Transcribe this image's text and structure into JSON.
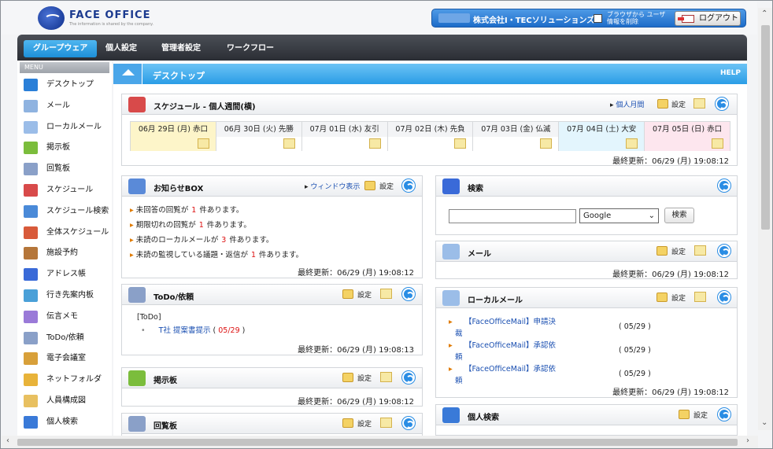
{
  "header": {
    "logo_text": "FACE OFFICE",
    "logo_tagline": "The information is shared by the company.",
    "company": "株式会社I・TECソリューションズ",
    "clear_option": "ブラウザから ユーザ情報を削除",
    "logout_label": "ログアウト"
  },
  "nav": {
    "tabs": [
      {
        "label": "グループウェア",
        "active": true
      },
      {
        "label": "個人設定",
        "active": false
      },
      {
        "label": "管理者設定",
        "active": false
      },
      {
        "label": "ワークフロー",
        "active": false
      }
    ]
  },
  "sidebar": {
    "header": "MENU",
    "items": [
      {
        "label": "デスクトップ",
        "icon": "home-arrow-icon",
        "color": "#2a7fd8"
      },
      {
        "label": "メール",
        "icon": "envelope-icon",
        "color": "#8fb3e0"
      },
      {
        "label": "ローカルメール",
        "icon": "local-mail-icon",
        "color": "#9bbde8"
      },
      {
        "label": "掲示板",
        "icon": "bulletin-board-icon",
        "color": "#7bbd3c"
      },
      {
        "label": "回覧板",
        "icon": "circular-board-icon",
        "color": "#8aa0c8"
      },
      {
        "label": "スケジュール",
        "icon": "schedule-icon",
        "color": "#d84a4a"
      },
      {
        "label": "スケジュール検索",
        "icon": "schedule-search-icon",
        "color": "#4a8ad8"
      },
      {
        "label": "全体スケジュール",
        "icon": "all-schedule-icon",
        "color": "#d85a3a"
      },
      {
        "label": "施設予約",
        "icon": "facility-door-icon",
        "color": "#b5763a"
      },
      {
        "label": "アドレス帳",
        "icon": "address-book-icon",
        "color": "#3a6ad8"
      },
      {
        "label": "行き先案内板",
        "icon": "destination-board-icon",
        "color": "#4aa0d8"
      },
      {
        "label": "伝言メモ",
        "icon": "memo-icon",
        "color": "#9a7ad8"
      },
      {
        "label": "ToDo/依頼",
        "icon": "todo-icon",
        "color": "#8aa0c8"
      },
      {
        "label": "電子会議室",
        "icon": "meeting-room-icon",
        "color": "#d8a03a"
      },
      {
        "label": "ネットフォルダ",
        "icon": "folder-icon",
        "color": "#e8b33a"
      },
      {
        "label": "人員構成図",
        "icon": "org-chart-icon",
        "color": "#e8c060"
      },
      {
        "label": "個人検索",
        "icon": "person-search-icon",
        "color": "#3a7ad8"
      }
    ]
  },
  "desktop": {
    "title": "デスクトップ",
    "help": "HELP"
  },
  "schedule": {
    "title": "スケジュール - 個人週間(横)",
    "monthly_link": "個人月間",
    "settings": "設定",
    "days": [
      {
        "label": "06月 29日 (月) 赤口",
        "bg": "#fdf5c9"
      },
      {
        "label": "06月 30日 (火) 先勝",
        "bg": "#ffffff"
      },
      {
        "label": "07月 01日 (水) 友引",
        "bg": "#ffffff"
      },
      {
        "label": "07月 02日 (木) 先負",
        "bg": "#ffffff"
      },
      {
        "label": "07月 03日 (金) 仏滅",
        "bg": "#ffffff"
      },
      {
        "label": "07月 04日 (土) 大安",
        "bg": "#e3f5fd"
      },
      {
        "label": "07月 05日 (日) 赤口",
        "bg": "#fde6ee"
      }
    ],
    "updated": "最終更新：06/29 (月) 19:08:12"
  },
  "notice": {
    "title": "お知らせBOX",
    "window_link": "ウィンドウ表示",
    "settings": "設定",
    "lines": [
      {
        "pre": "未回答の回覧が",
        "num": "1",
        "post": "件あります。"
      },
      {
        "pre": "期限切れの回覧が",
        "num": "1",
        "post": "件あります。"
      },
      {
        "pre": "未読のローカルメールが",
        "num": "3",
        "post": "件あります。"
      },
      {
        "pre": "未読の監視している議題・返信が",
        "num": "1",
        "post": "件あります。"
      }
    ],
    "updated": "最終更新：06/29 (月) 19:08:12"
  },
  "search": {
    "title": "検索",
    "engine": "Google",
    "button": "検索",
    "query": ""
  },
  "mail": {
    "title": "メール",
    "settings": "設定",
    "updated": "最終更新：06/29 (月) 19:08:12"
  },
  "todo": {
    "title": "ToDo/依頼",
    "settings": "設定",
    "section": "[ToDo]",
    "item_text": "T社 提案書提示",
    "item_date": "05/29",
    "updated": "最終更新：06/29 (月) 19:08:13"
  },
  "localmail": {
    "title": "ローカルメール",
    "settings": "設定",
    "items": [
      {
        "line1": "【FaceOfficeMail】申請決",
        "line2": "裁",
        "date": "( 05/29 )"
      },
      {
        "line1": "【FaceOfficeMail】承認依",
        "line2": "頼",
        "date": "( 05/29 )"
      },
      {
        "line1": "【FaceOfficeMail】承認依",
        "line2": "頼",
        "date": "( 05/29 )"
      }
    ],
    "updated": "最終更新：06/29 (月) 19:08:12"
  },
  "bulletin": {
    "title": "掲示板",
    "settings": "設定",
    "updated": "最終更新：06/29 (月) 19:08:12"
  },
  "circular": {
    "title": "回覧板",
    "settings": "設定"
  },
  "personsearch": {
    "title": "個人検索",
    "settings": "設定"
  }
}
